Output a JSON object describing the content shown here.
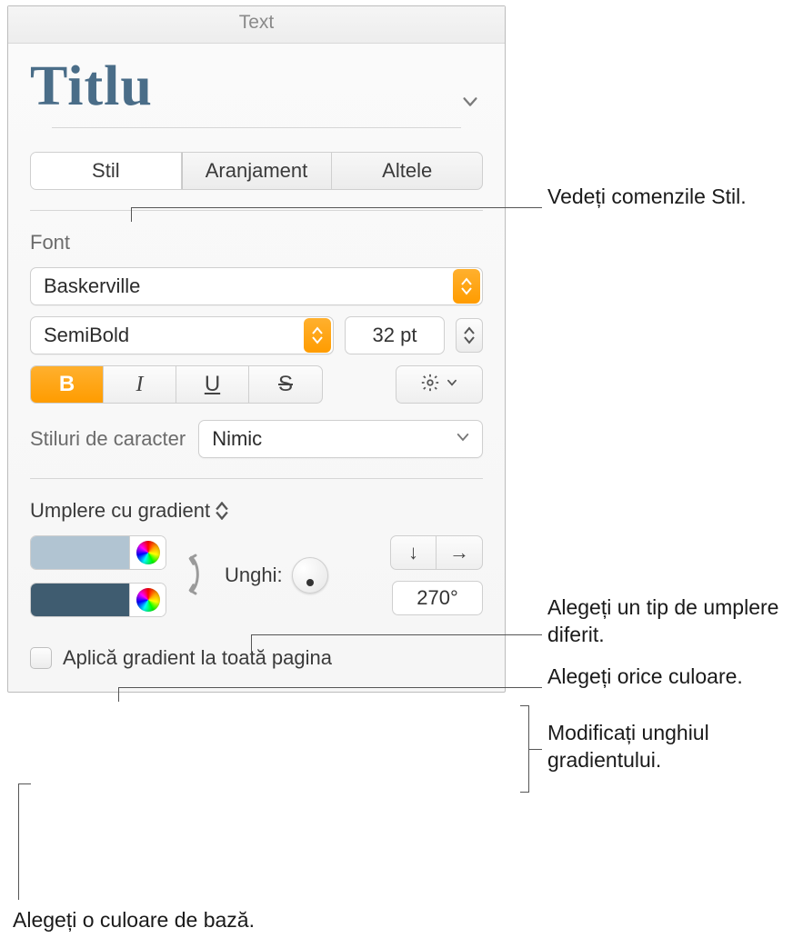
{
  "header": {
    "title": "Text"
  },
  "title": {
    "text": "Titlu"
  },
  "tabs": {
    "stil": "Stil",
    "aranjament": "Aranjament",
    "altele": "Altele"
  },
  "font": {
    "label": "Font",
    "family": "Baskerville",
    "weight": "SemiBold",
    "size": "32 pt",
    "char_styles_label": "Stiluri de caracter",
    "char_styles_value": "Nimic"
  },
  "fill": {
    "label": "Umplere cu gradient",
    "swatch1": "#b1c4d2",
    "swatch2": "#3f5c70",
    "angle_label": "Unghi:",
    "angle_value": "270°",
    "apply_label": "Aplică gradient la toată pagina"
  },
  "callouts": {
    "c1": "Vedeți comenzile Stil.",
    "c2": "Alegeți un tip de umplere diferit.",
    "c3": "Alegeți orice culoare.",
    "c4a": "Modificați unghiul",
    "c4b": "gradientului.",
    "c5": "Alegeți o culoare de bază."
  }
}
